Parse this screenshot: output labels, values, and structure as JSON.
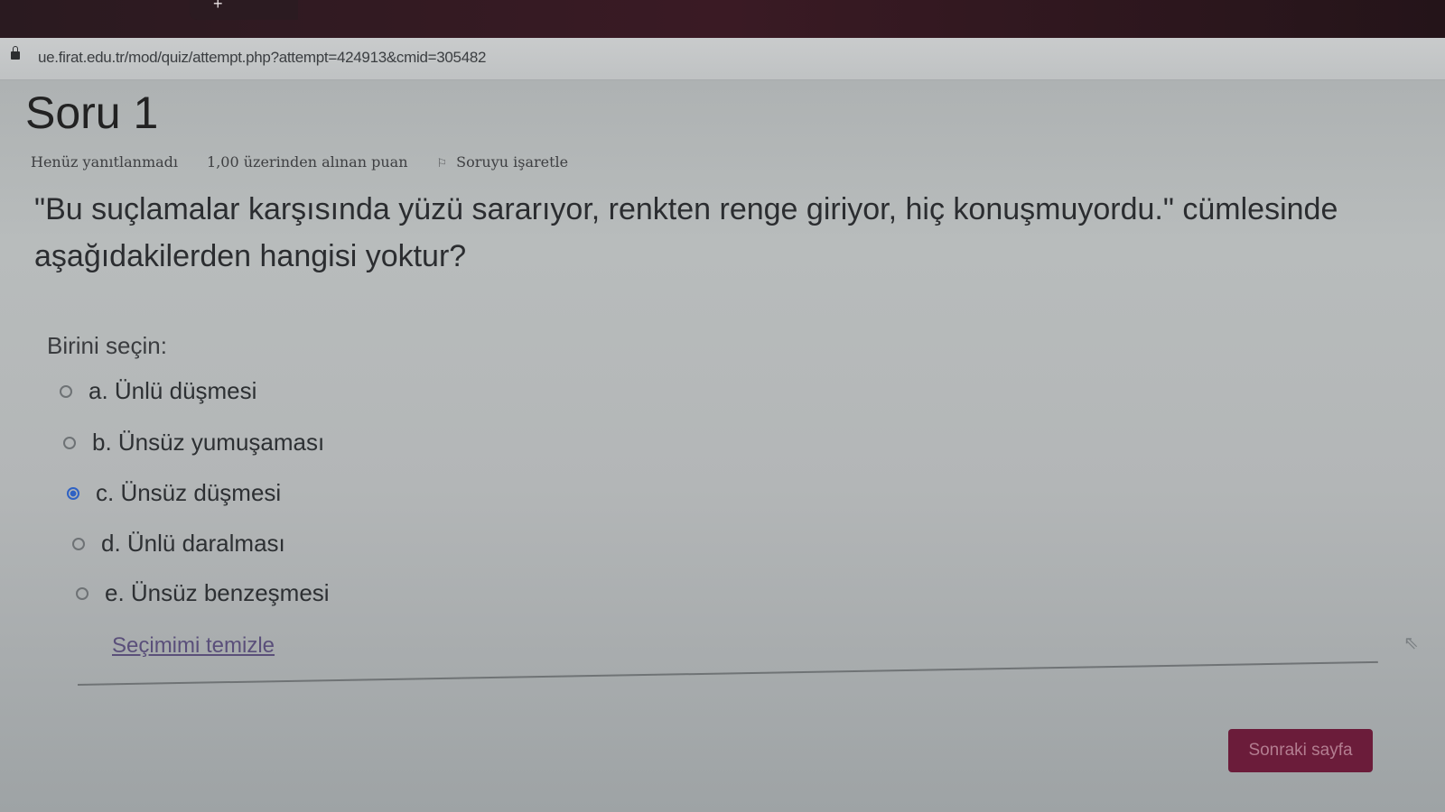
{
  "browser": {
    "url": "ue.firat.edu.tr/mod/quiz/attempt.php?attempt=424913&cmid=305482",
    "new_tab_symbol": "+"
  },
  "question": {
    "title": "Soru 1",
    "status": "Henüz yanıtlanmadı",
    "points": "1,00 üzerinden alınan puan",
    "flag_label": "Soruyu işaretle",
    "text": "\"Bu suçlamalar karşısında yüzü sararıyor, renkten renge giriyor, hiç konuşmuyordu.\" cümlesinde aşağıdakilerden hangisi yoktur?",
    "choose_label": "Birini seçin:",
    "options": [
      {
        "label": "a. Ünlü düşmesi",
        "selected": false
      },
      {
        "label": "b. Ünsüz yumuşaması",
        "selected": false
      },
      {
        "label": "c. Ünsüz düşmesi",
        "selected": true
      },
      {
        "label": "d. Ünlü daralması",
        "selected": false
      },
      {
        "label": "e. Ünsüz benzeşmesi",
        "selected": false
      }
    ],
    "clear_label": "Seçimimi temizle"
  },
  "navigation": {
    "next_label": "Sonraki sayfa"
  },
  "colors": {
    "accent": "#6b1c3a",
    "radio_selected": "#2f62c4"
  }
}
